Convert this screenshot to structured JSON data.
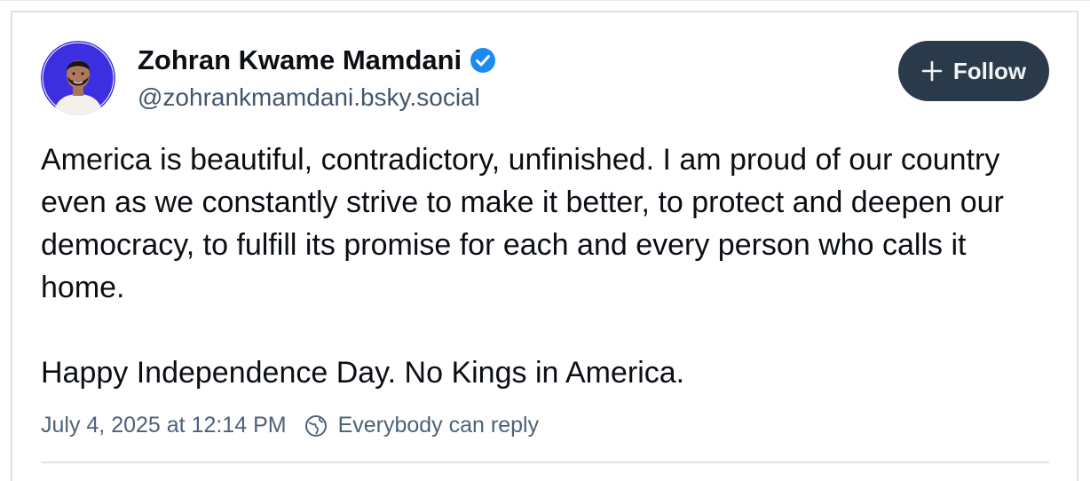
{
  "author": {
    "display_name": "Zohran Kwame Mamdani",
    "handle": "@zohrankmamdani.bsky.social",
    "verified": true
  },
  "actions": {
    "follow_label": "Follow"
  },
  "post": {
    "paragraphs": [
      "America is beautiful, contradictory, unfinished. I am proud of our country even as we constantly strive to make it better, to protect and deepen our democracy, to fulfill its promise for each and every person who calls it home.",
      "Happy Independence Day. No Kings in America."
    ],
    "timestamp": "July 4, 2025 at 12:14 PM",
    "reply_setting": "Everybody can reply"
  },
  "colors": {
    "accent_blue": "#1d8af2",
    "avatar_bg": "#3b2fe0",
    "follow_bg": "#2b3a4a",
    "muted_text": "#4b627b"
  },
  "icons": {
    "verified": "verified-check-icon",
    "follow": "plus-icon",
    "reply": "globe-icon"
  }
}
